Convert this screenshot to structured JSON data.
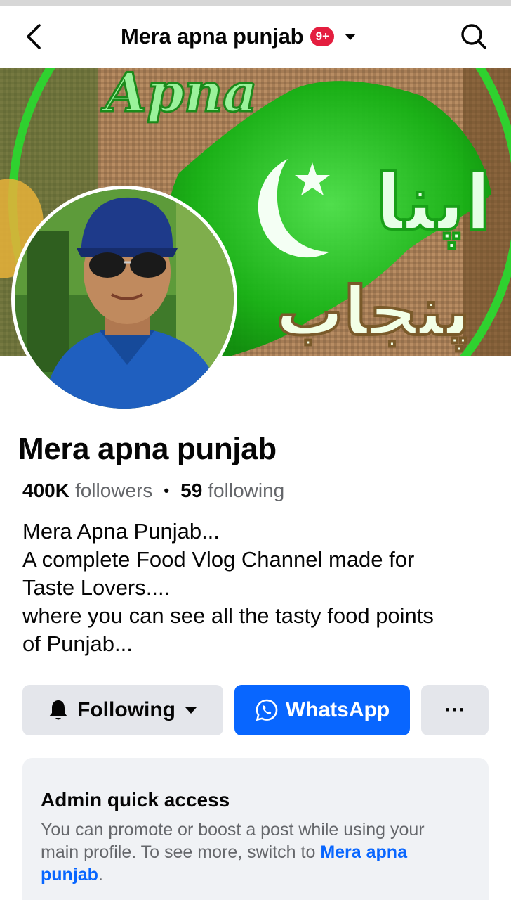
{
  "header": {
    "title": "Mera apna punjab",
    "notification_badge": "9+"
  },
  "cover": {
    "text_latin": "Apna",
    "text_urdu_line1": "اپنا",
    "text_urdu_line2": "پنجاب",
    "accent_color": "#1fc41f"
  },
  "profile": {
    "name": "Mera apna punjab",
    "followers_count": "400K",
    "followers_label": "followers",
    "separator": "•",
    "following_count": "59",
    "following_label": "following",
    "bio_lines": [
      "Mera Apna Punjab...",
      "A complete Food Vlog Channel made for",
      "Taste Lovers....",
      "where you can see all the tasty food points",
      "of Punjab..."
    ]
  },
  "actions": {
    "following_label": "Following",
    "whatsapp_label": "WhatsApp",
    "more_label": "···"
  },
  "admin": {
    "title": "Admin quick access",
    "text": "You can promote or boost a post while using your main profile. To see more, switch to ",
    "link": "Mera apna punjab",
    "end": "."
  },
  "colors": {
    "primary": "#0866ff",
    "badge": "#e41e3f",
    "secondary_button": "#e4e6eb",
    "card_background": "#f0f2f5",
    "muted_text": "#65676b"
  }
}
